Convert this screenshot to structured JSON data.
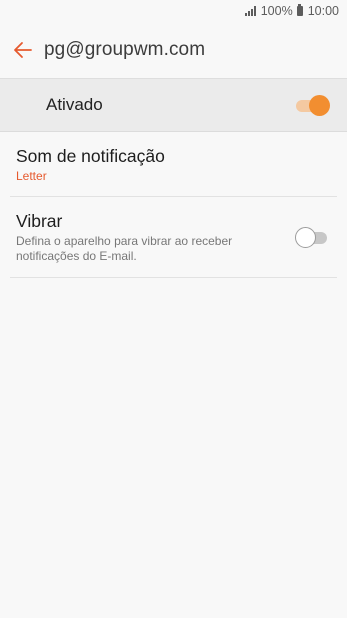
{
  "status_bar": {
    "battery": "100%",
    "time": "10:00"
  },
  "header": {
    "back_icon": "arrow-left-icon",
    "title": "pg@groupwm.com"
  },
  "master_switch": {
    "label": "Ativado",
    "state": "on"
  },
  "settings": {
    "notification_sound": {
      "title": "Som de notificação",
      "value": "Letter"
    },
    "vibrate": {
      "title": "Vibrar",
      "description": "Defina o aparelho para vibrar ao receber notificações do E-mail.",
      "state": "off"
    }
  },
  "colors": {
    "accent": "#e65a2e",
    "toggle_on": "#f28e30",
    "toggle_on_track": "#f4c9a1"
  }
}
